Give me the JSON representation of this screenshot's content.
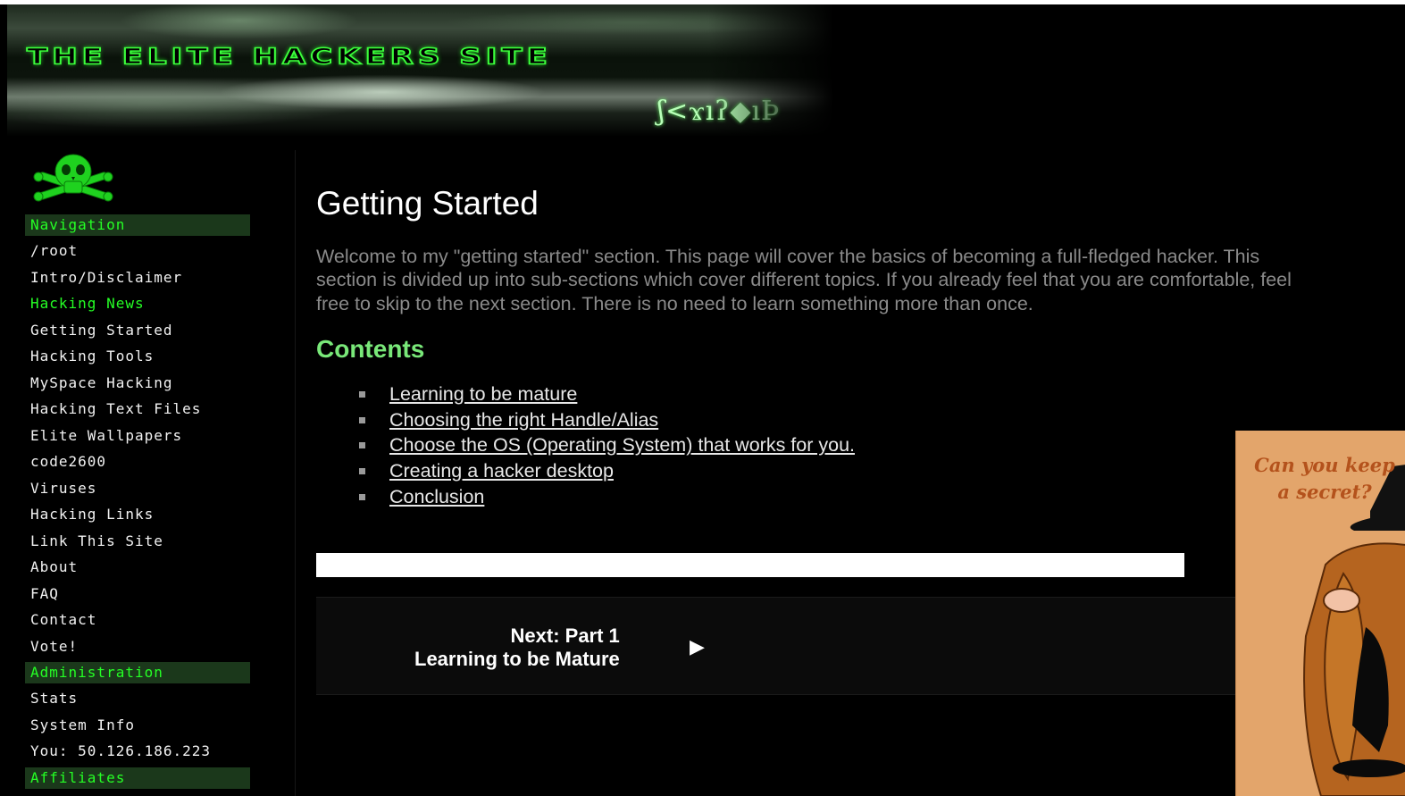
{
  "header": {
    "site_title": "THE ELITE HACKERS SITE",
    "signature": "ʃ<ϫıʔ◆ıϷ"
  },
  "sidebar": {
    "logo_icon": "skull-crossbones-icon",
    "sections": [
      {
        "header": "Navigation",
        "items": [
          "/root",
          "Intro/Disclaimer",
          "Hacking News",
          "Getting Started",
          "Hacking Tools",
          "MySpace Hacking",
          "Hacking Text Files",
          "Elite Wallpapers",
          "code2600",
          "Viruses",
          "Hacking Links",
          "Link This Site",
          "About",
          "FAQ",
          "Contact",
          "Vote!"
        ]
      },
      {
        "header": "Administration",
        "items": [
          "Stats",
          "System Info",
          "You: 50.126.186.223"
        ]
      },
      {
        "header": "Affiliates",
        "items": []
      }
    ],
    "highlighted_item": "Hacking News"
  },
  "main": {
    "title": "Getting Started",
    "intro": "Welcome to my \"getting started\" section. This page will cover the basics of becoming a full-fledged hacker. This section is divided up into sub-sections which cover different topics. If you already feel that you are comfortable, feel free to skip to the next section. There is no need to learn something more than once.",
    "contents_heading": "Contents",
    "contents": [
      "Learning to be mature",
      "Choosing the right Handle/Alias",
      "Choose the OS (Operating System) that works for you.",
      "Creating a hacker desktop",
      "Conclusion"
    ],
    "next": {
      "line1": "Next: Part 1",
      "line2": "Learning to be Mature",
      "arrow": "▶"
    }
  },
  "ad": {
    "text": "Can you keep a secret?"
  },
  "colors": {
    "accent_green": "#25ff25",
    "section_header_bg": "#1b381b",
    "contents_heading": "#79e879",
    "ad_bg": "#e3a56b"
  }
}
